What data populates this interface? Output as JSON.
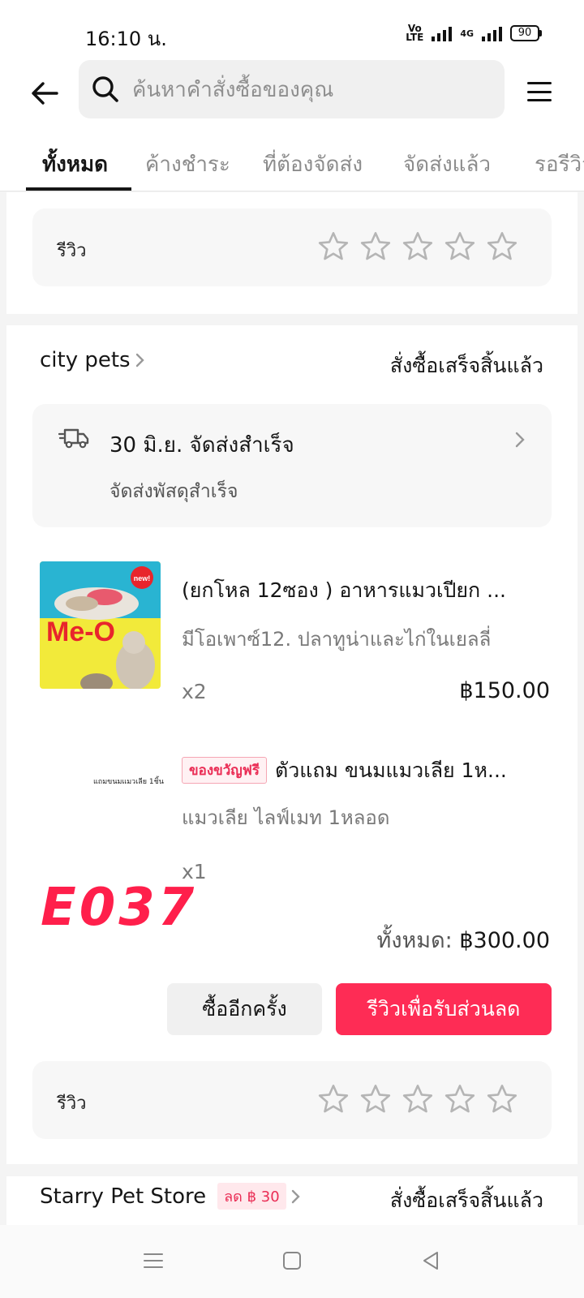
{
  "status": {
    "time": "16:10 น.",
    "volte": "Vo LTE",
    "network": "4G",
    "battery": "90"
  },
  "header": {
    "search_placeholder": "ค้นหาคำสั่งซื้อของคุณ"
  },
  "tabs": [
    {
      "label": "ทั้งหมด",
      "active": true
    },
    {
      "label": "ค้างชำระ",
      "active": false
    },
    {
      "label": "ที่ต้องจัดส่ง",
      "active": false
    },
    {
      "label": "จัดส่งแล้ว",
      "active": false
    },
    {
      "label": "รอรีวิว",
      "active": false
    }
  ],
  "prev_order": {
    "review_label": "รีวิว",
    "rating": 0
  },
  "order": {
    "store_name": "city pets",
    "status": "สั่งซื้อเสร็จสิ้นแล้ว",
    "shipping": {
      "title": "30 มิ.ย. จัดส่งสำเร็จ",
      "subtitle": "จัดส่งพัสดุสำเร็จ"
    },
    "items": [
      {
        "title": "(ยกโหล 12ซอง ) อาหารแมวเปียก ...",
        "variant": "มีโอเพาซ์12. ปลาทูน่าและไก่ในเยลลี่",
        "qty": "x2",
        "price": "฿150.00",
        "image_brand": "Me-O",
        "image_badge": "new!"
      },
      {
        "badge": "ของขวัญฟรี",
        "title": "ตัวแถม ขนมแมวเลีย 1ห...",
        "variant": "แมวเลีย ไลฟ์เมท 1หลอด",
        "qty": "x1",
        "image_caption": "แถมขนมแมวเลีย 1ชิ้น"
      }
    ],
    "total_label": "ทั้งหมด:",
    "total_value": "฿300.00",
    "buy_again_label": "ซื้ออีกครั้ง",
    "review_button_label": "รีวิวเพื่อรับส่วนลด",
    "review_label": "รีวิว",
    "rating": 0
  },
  "watermark": "E037",
  "next_order": {
    "store_name": "Starry Pet Store",
    "discount_badge": "ลด ฿ 30",
    "status": "สั่งซื้อเสร็จสิ้นแล้ว"
  },
  "colors": {
    "accent": "#fe2c55",
    "watermark": "#ff1f4b"
  }
}
